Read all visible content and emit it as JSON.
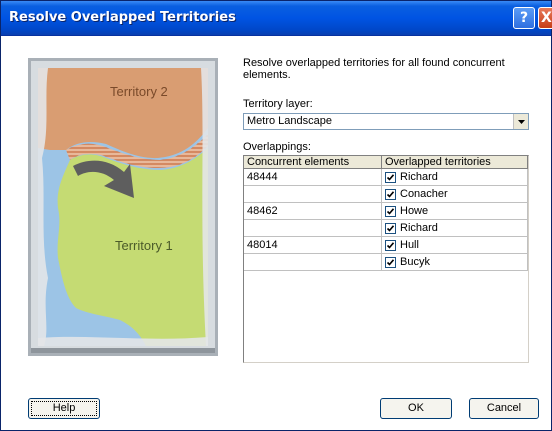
{
  "window": {
    "title": "Resolve Overlapped Territories",
    "help_glyph": "?",
    "close_glyph": "X"
  },
  "illustration": {
    "territory2_label": "Territory 2",
    "territory1_label": "Territory 1"
  },
  "description": "Resolve overlapped territories for all found concurrent elements.",
  "territory_layer": {
    "label": "Territory layer:",
    "value": "Metro Landscape"
  },
  "overlappings": {
    "label": "Overlappings:",
    "columns": [
      "Concurrent elements",
      "Overlapped territories"
    ],
    "rows": [
      {
        "element": "48444",
        "territory": "Richard",
        "checked": true
      },
      {
        "element": "",
        "territory": "Conacher",
        "checked": true
      },
      {
        "element": "48462",
        "territory": "Howe",
        "checked": true
      },
      {
        "element": "",
        "territory": "Richard",
        "checked": true
      },
      {
        "element": "48014",
        "territory": "Hull",
        "checked": true
      },
      {
        "element": "",
        "territory": "Bucyk",
        "checked": true
      }
    ]
  },
  "buttons": {
    "help": "Help",
    "ok": "OK",
    "cancel": "Cancel"
  }
}
